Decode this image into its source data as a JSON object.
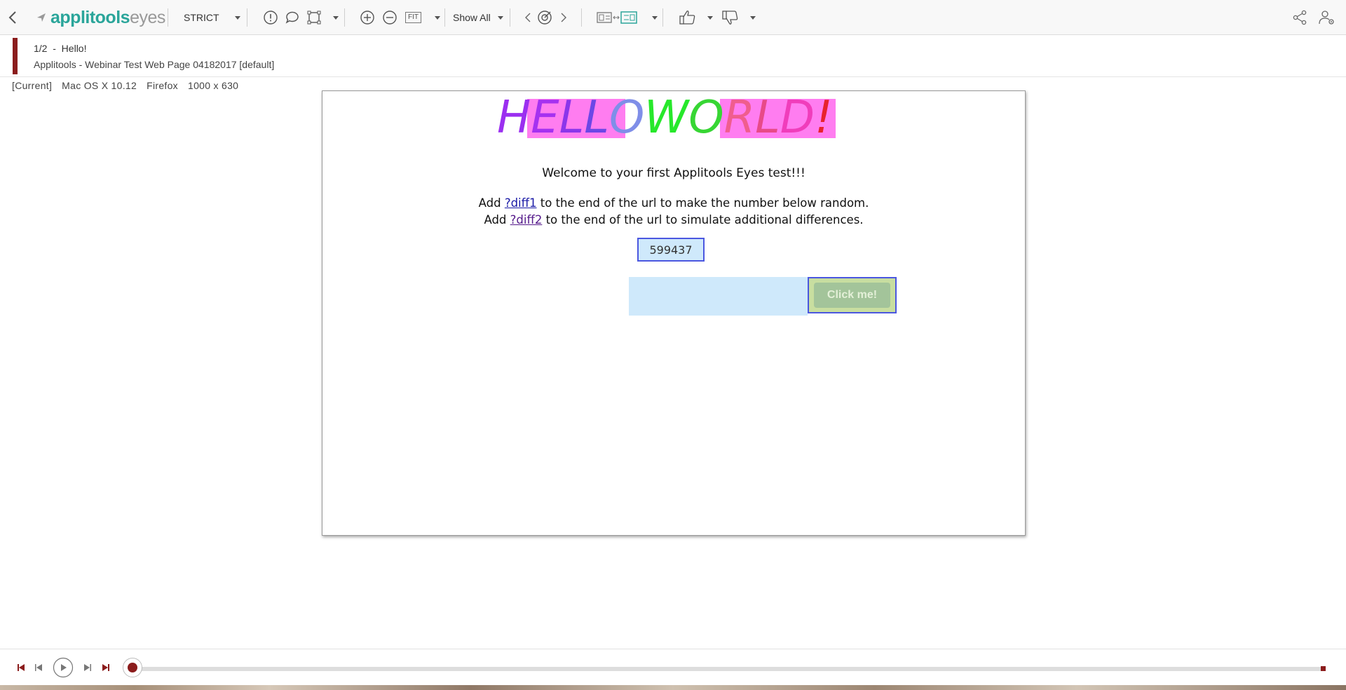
{
  "toolbar": {
    "logo_bold": "applitools",
    "logo_light": "eyes",
    "match_level": "STRICT",
    "zoom_fit": "FIT",
    "show_filter": "Show All"
  },
  "header": {
    "step": "1/2  -  Hello!",
    "test_name": "Applitools - Webinar Test Web Page 04182017 [default]",
    "env": {
      "current": "[Current]",
      "os": "Mac OS X 10.12",
      "browser": "Firefox",
      "viewport": "1000 x 630"
    }
  },
  "page": {
    "hello_word": "HELLO",
    "world_word": "WORLD!",
    "hello_colors": [
      "#9b2ff0",
      "#a531f0",
      "#8b36ea",
      "#6c47e6",
      "#7f8ee8"
    ],
    "world_colors": [
      "#27e82b",
      "#37d634",
      "#f05d8e",
      "#e84a88",
      "#f03dbb",
      "#e8222d"
    ],
    "welcome": "Welcome to your first Applitools Eyes test!!!",
    "line1_pre": "Add ",
    "line1_link": "?diff1",
    "line1_post": " to the end of the url to make the number below random.",
    "line2_pre": "Add ",
    "line2_link": "?diff2",
    "line2_post": " to the end of the url to simulate additional differences.",
    "number": "599437",
    "button": "Click me!"
  },
  "colors": {
    "brand": "#2aa59a",
    "step_indicator": "#8b1c1c",
    "diff_highlight": "#ff7df0",
    "diff_border": "#4b57e0"
  }
}
